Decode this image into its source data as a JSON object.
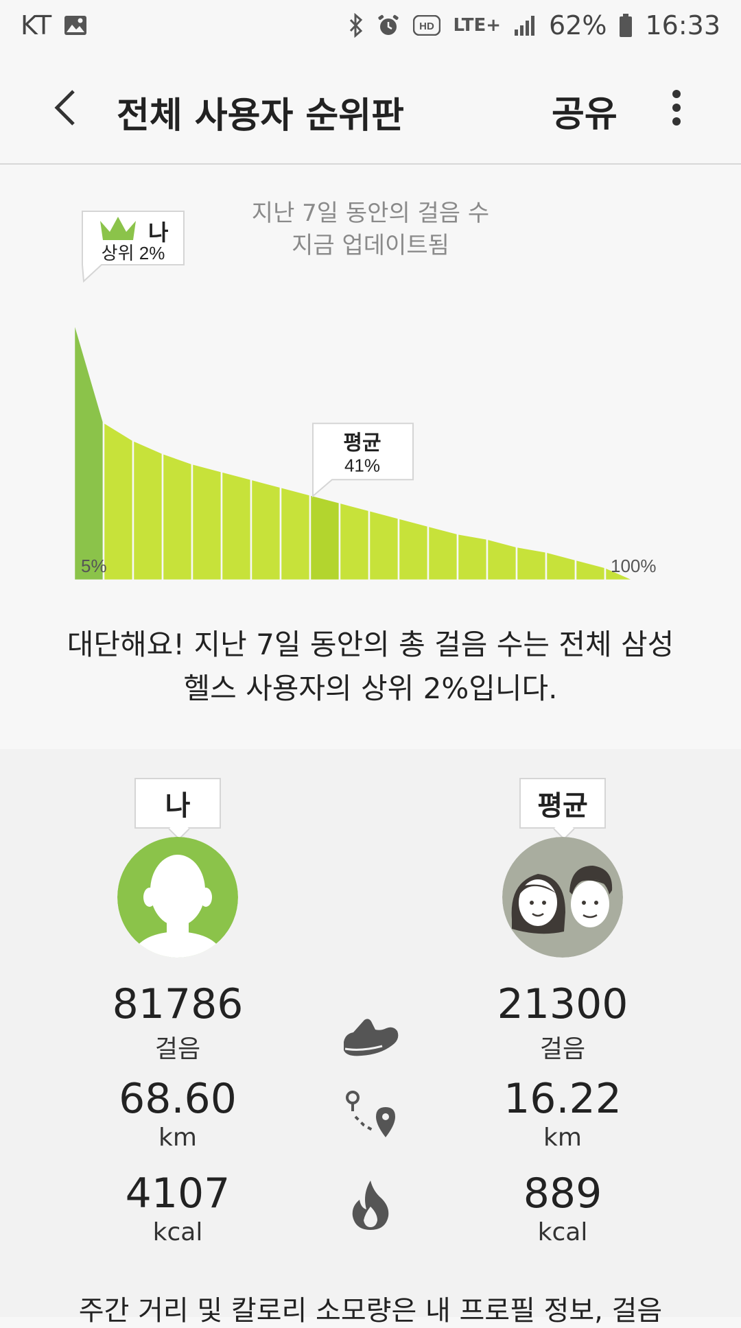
{
  "status_bar": {
    "carrier": "KT",
    "network": "LTE+",
    "battery": "62%",
    "time": "16:33"
  },
  "app_bar": {
    "title": "전체 사용자 순위판",
    "share_label": "공유"
  },
  "chart": {
    "caption_line1": "지난 7일 동안의 걸음 수",
    "caption_line2": "지금 업데이트됨",
    "me_label": "나",
    "me_rank": "상위 2%",
    "avg_label": "평균",
    "avg_rank": "41%",
    "x_start_label": "5%",
    "x_end_label": "100%"
  },
  "chart_data": {
    "type": "area",
    "x": [
      5,
      10,
      15,
      20,
      25,
      30,
      35,
      40,
      45,
      50,
      55,
      60,
      65,
      70,
      75,
      80,
      85,
      90,
      95,
      100
    ],
    "values": [
      100,
      61,
      54,
      49,
      45,
      42,
      39,
      36,
      33,
      30,
      27,
      24,
      21,
      18,
      16,
      13,
      11,
      8,
      5,
      0
    ],
    "highlight": [
      {
        "label": "나",
        "percentile": 2
      },
      {
        "label": "평균",
        "percentile": 41
      }
    ],
    "colors": {
      "bar": "#c7e23a",
      "me": "#8bc34a",
      "average": "#b3d52e"
    }
  },
  "summary": {
    "line1": "대단해요! 지난 7일 동안의 총 걸음 수는 전체 삼성",
    "line2": "헬스 사용자의 상위 2%입니다."
  },
  "stats": {
    "me": {
      "label": "나",
      "steps": "81786",
      "steps_unit": "걸음",
      "distance": "68.60",
      "distance_unit": "km",
      "calories": "4107",
      "calories_unit": "kcal"
    },
    "average": {
      "label": "평균",
      "steps": "21300",
      "steps_unit": "걸음",
      "distance": "16.22",
      "distance_unit": "km",
      "calories": "889",
      "calories_unit": "kcal"
    },
    "icons": [
      "shoe-icon",
      "route-icon",
      "flame-icon"
    ]
  },
  "footnote": "주간 거리 및 칼로리 소모량은 내 프로필 정보, 걸음"
}
